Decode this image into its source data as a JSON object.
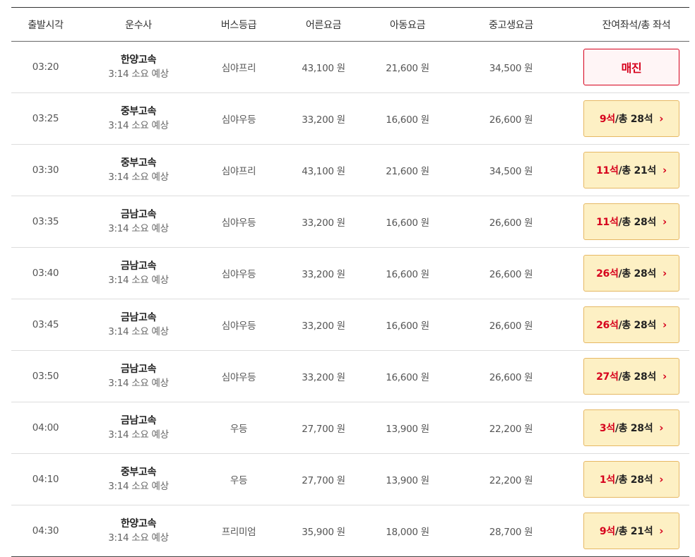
{
  "headers": [
    "출발시각",
    "운수사",
    "버스등급",
    "어른요금",
    "아동요금",
    "중고생요금",
    "잔여좌석/총 좌석"
  ],
  "rows": [
    {
      "time": "03:20",
      "company": "한양고속",
      "duration": "3:14 소요 예상",
      "grade": "심야프리",
      "adult": "43,100 원",
      "child": "21,600 원",
      "teen": "34,500 원",
      "soldout": "매진"
    },
    {
      "time": "03:25",
      "company": "중부고속",
      "duration": "3:14 소요 예상",
      "grade": "심야우등",
      "adult": "33,200 원",
      "child": "16,600 원",
      "teen": "26,600 원",
      "remaining": "9석",
      "total": " /총 28석"
    },
    {
      "time": "03:30",
      "company": "중부고속",
      "duration": "3:14 소요 예상",
      "grade": "심야프리",
      "adult": "43,100 원",
      "child": "21,600 원",
      "teen": "34,500 원",
      "remaining": "11석",
      "total": " /총 21석"
    },
    {
      "time": "03:35",
      "company": "금남고속",
      "duration": "3:14 소요 예상",
      "grade": "심야우등",
      "adult": "33,200 원",
      "child": "16,600 원",
      "teen": "26,600 원",
      "remaining": "11석",
      "total": " /총 28석"
    },
    {
      "time": "03:40",
      "company": "금남고속",
      "duration": "3:14 소요 예상",
      "grade": "심야우등",
      "adult": "33,200 원",
      "child": "16,600 원",
      "teen": "26,600 원",
      "remaining": "26석",
      "total": " /총 28석"
    },
    {
      "time": "03:45",
      "company": "금남고속",
      "duration": "3:14 소요 예상",
      "grade": "심야우등",
      "adult": "33,200 원",
      "child": "16,600 원",
      "teen": "26,600 원",
      "remaining": "26석",
      "total": " /총 28석"
    },
    {
      "time": "03:50",
      "company": "금남고속",
      "duration": "3:14 소요 예상",
      "grade": "심야우등",
      "adult": "33,200 원",
      "child": "16,600 원",
      "teen": "26,600 원",
      "remaining": "27석",
      "total": " /총 28석"
    },
    {
      "time": "04:00",
      "company": "금남고속",
      "duration": "3:14 소요 예상",
      "grade": "우등",
      "adult": "27,700 원",
      "child": "13,900 원",
      "teen": "22,200 원",
      "remaining": "3석",
      "total": " /총 28석"
    },
    {
      "time": "04:10",
      "company": "중부고속",
      "duration": "3:14 소요 예상",
      "grade": "우등",
      "adult": "27,700 원",
      "child": "13,900 원",
      "teen": "22,200 원",
      "remaining": "1석",
      "total": " /총 28석"
    },
    {
      "time": "04:30",
      "company": "한양고속",
      "duration": "3:14 소요 예상",
      "grade": "프리미엄",
      "adult": "35,900 원",
      "child": "18,000 원",
      "teen": "28,700 원",
      "remaining": "9석",
      "total": " /총 21석"
    }
  ],
  "icons": {
    "seat_arrow": "chevron-right-icon"
  },
  "colors": {
    "accent_red": "#d6001c",
    "seat_button_bg": "#fdf0c4",
    "seat_button_border": "#e6b864"
  }
}
